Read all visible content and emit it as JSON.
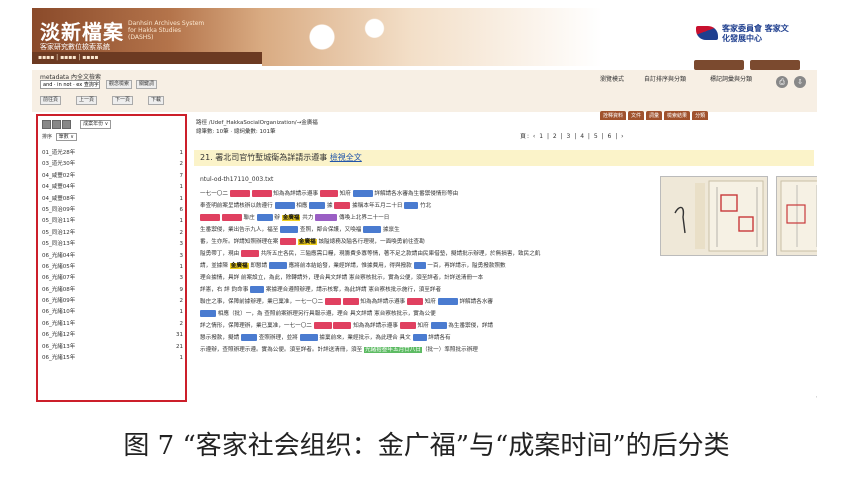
{
  "banner": {
    "brand_title": "淡新檔案",
    "brand_en": "Danhsin Archives System for Hakka Studies (DASHS)",
    "brand_sub": "客家研究數位檢索系統",
    "logo_text": "客家委員會 客家文化發展中心"
  },
  "search": {
    "meta_label": "metadata 內全文檢索",
    "input_value": "and · in not · ex 查詢字句",
    "buttons": [
      "觀念檢索",
      "關鍵詞"
    ],
    "filter_buttons": [
      "前往頁",
      "上一頁",
      "下一頁",
      "下載"
    ],
    "right_controls": [
      "瀏覽模式",
      "自訂排序與分類",
      "標記詞彙與分類"
    ],
    "tabs": [
      "詮釋資料",
      "文件",
      "詞彙",
      "檢索結果",
      "分類"
    ]
  },
  "sidebar": {
    "group_select": "成案年份 ∨",
    "sort_label": "排序",
    "sort_select": "筆數 ∨",
    "items": [
      {
        "label": "01_道光28年",
        "count": "1"
      },
      {
        "label": "03_道光30年",
        "count": "2"
      },
      {
        "label": "04_咸豐02年",
        "count": "7"
      },
      {
        "label": "04_咸豐04年",
        "count": "1"
      },
      {
        "label": "04_咸豐08年",
        "count": "1"
      },
      {
        "label": "05_同治09年",
        "count": "6"
      },
      {
        "label": "05_同治11年",
        "count": "1"
      },
      {
        "label": "05_同治12年",
        "count": "2"
      },
      {
        "label": "05_同治13年",
        "count": "3"
      },
      {
        "label": "06_光緒04年",
        "count": "3"
      },
      {
        "label": "06_光緒05年",
        "count": "1"
      },
      {
        "label": "06_光緒07年",
        "count": "3"
      },
      {
        "label": "06_光緒08年",
        "count": "9"
      },
      {
        "label": "06_光緒09年",
        "count": "2"
      },
      {
        "label": "06_光緒10年",
        "count": "1"
      },
      {
        "label": "06_光緒11年",
        "count": "2"
      },
      {
        "label": "06_光緒12年",
        "count": "31"
      },
      {
        "label": "06_光緒13年",
        "count": "21"
      },
      {
        "label": "06_光緒15年",
        "count": "1"
      }
    ]
  },
  "main": {
    "path": "路徑 /Udef_HakkaSocialOrganization/→金廣福",
    "count": "總筆數: 10筆 · 總詞彙數: 101筆",
    "pager": "頁: ‹ 1 | 2 | 3 | 4 | 5 | 6 | ›",
    "pager_current": "2",
    "doc_title_num": "21. ",
    "doc_title": "署北司官竹塹城衛為詳請示遵事",
    "doc_title_link": "檢視全文",
    "doc_id": "ntul-od-th17110_003.txt",
    "keyword": "金廣福",
    "footer_hl": "光緒拾叁年五月廿八日"
  },
  "caption": "图 7 “客家社会组织：金广福”与“成案时间”的后分类"
}
